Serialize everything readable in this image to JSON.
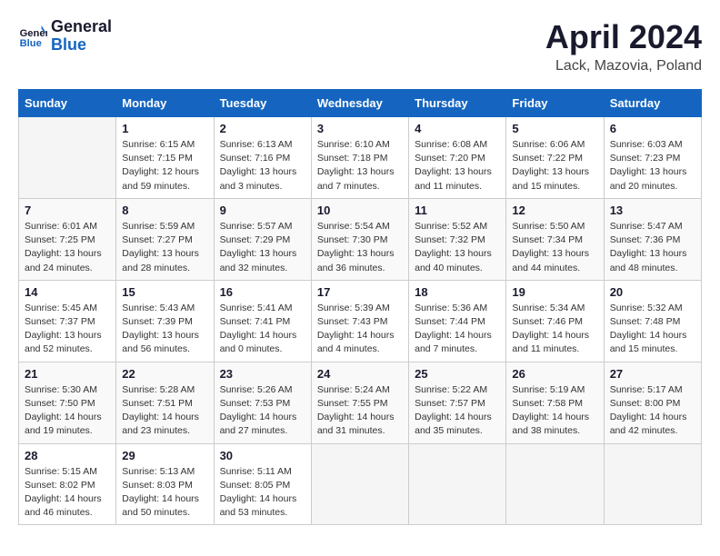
{
  "header": {
    "logo_line1": "General",
    "logo_line2": "Blue",
    "month_year": "April 2024",
    "location": "Lack, Mazovia, Poland"
  },
  "weekdays": [
    "Sunday",
    "Monday",
    "Tuesday",
    "Wednesday",
    "Thursday",
    "Friday",
    "Saturday"
  ],
  "weeks": [
    [
      {
        "day": "",
        "info": ""
      },
      {
        "day": "1",
        "info": "Sunrise: 6:15 AM\nSunset: 7:15 PM\nDaylight: 12 hours\nand 59 minutes."
      },
      {
        "day": "2",
        "info": "Sunrise: 6:13 AM\nSunset: 7:16 PM\nDaylight: 13 hours\nand 3 minutes."
      },
      {
        "day": "3",
        "info": "Sunrise: 6:10 AM\nSunset: 7:18 PM\nDaylight: 13 hours\nand 7 minutes."
      },
      {
        "day": "4",
        "info": "Sunrise: 6:08 AM\nSunset: 7:20 PM\nDaylight: 13 hours\nand 11 minutes."
      },
      {
        "day": "5",
        "info": "Sunrise: 6:06 AM\nSunset: 7:22 PM\nDaylight: 13 hours\nand 15 minutes."
      },
      {
        "day": "6",
        "info": "Sunrise: 6:03 AM\nSunset: 7:23 PM\nDaylight: 13 hours\nand 20 minutes."
      }
    ],
    [
      {
        "day": "7",
        "info": "Sunrise: 6:01 AM\nSunset: 7:25 PM\nDaylight: 13 hours\nand 24 minutes."
      },
      {
        "day": "8",
        "info": "Sunrise: 5:59 AM\nSunset: 7:27 PM\nDaylight: 13 hours\nand 28 minutes."
      },
      {
        "day": "9",
        "info": "Sunrise: 5:57 AM\nSunset: 7:29 PM\nDaylight: 13 hours\nand 32 minutes."
      },
      {
        "day": "10",
        "info": "Sunrise: 5:54 AM\nSunset: 7:30 PM\nDaylight: 13 hours\nand 36 minutes."
      },
      {
        "day": "11",
        "info": "Sunrise: 5:52 AM\nSunset: 7:32 PM\nDaylight: 13 hours\nand 40 minutes."
      },
      {
        "day": "12",
        "info": "Sunrise: 5:50 AM\nSunset: 7:34 PM\nDaylight: 13 hours\nand 44 minutes."
      },
      {
        "day": "13",
        "info": "Sunrise: 5:47 AM\nSunset: 7:36 PM\nDaylight: 13 hours\nand 48 minutes."
      }
    ],
    [
      {
        "day": "14",
        "info": "Sunrise: 5:45 AM\nSunset: 7:37 PM\nDaylight: 13 hours\nand 52 minutes."
      },
      {
        "day": "15",
        "info": "Sunrise: 5:43 AM\nSunset: 7:39 PM\nDaylight: 13 hours\nand 56 minutes."
      },
      {
        "day": "16",
        "info": "Sunrise: 5:41 AM\nSunset: 7:41 PM\nDaylight: 14 hours\nand 0 minutes."
      },
      {
        "day": "17",
        "info": "Sunrise: 5:39 AM\nSunset: 7:43 PM\nDaylight: 14 hours\nand 4 minutes."
      },
      {
        "day": "18",
        "info": "Sunrise: 5:36 AM\nSunset: 7:44 PM\nDaylight: 14 hours\nand 7 minutes."
      },
      {
        "day": "19",
        "info": "Sunrise: 5:34 AM\nSunset: 7:46 PM\nDaylight: 14 hours\nand 11 minutes."
      },
      {
        "day": "20",
        "info": "Sunrise: 5:32 AM\nSunset: 7:48 PM\nDaylight: 14 hours\nand 15 minutes."
      }
    ],
    [
      {
        "day": "21",
        "info": "Sunrise: 5:30 AM\nSunset: 7:50 PM\nDaylight: 14 hours\nand 19 minutes."
      },
      {
        "day": "22",
        "info": "Sunrise: 5:28 AM\nSunset: 7:51 PM\nDaylight: 14 hours\nand 23 minutes."
      },
      {
        "day": "23",
        "info": "Sunrise: 5:26 AM\nSunset: 7:53 PM\nDaylight: 14 hours\nand 27 minutes."
      },
      {
        "day": "24",
        "info": "Sunrise: 5:24 AM\nSunset: 7:55 PM\nDaylight: 14 hours\nand 31 minutes."
      },
      {
        "day": "25",
        "info": "Sunrise: 5:22 AM\nSunset: 7:57 PM\nDaylight: 14 hours\nand 35 minutes."
      },
      {
        "day": "26",
        "info": "Sunrise: 5:19 AM\nSunset: 7:58 PM\nDaylight: 14 hours\nand 38 minutes."
      },
      {
        "day": "27",
        "info": "Sunrise: 5:17 AM\nSunset: 8:00 PM\nDaylight: 14 hours\nand 42 minutes."
      }
    ],
    [
      {
        "day": "28",
        "info": "Sunrise: 5:15 AM\nSunset: 8:02 PM\nDaylight: 14 hours\nand 46 minutes."
      },
      {
        "day": "29",
        "info": "Sunrise: 5:13 AM\nSunset: 8:03 PM\nDaylight: 14 hours\nand 50 minutes."
      },
      {
        "day": "30",
        "info": "Sunrise: 5:11 AM\nSunset: 8:05 PM\nDaylight: 14 hours\nand 53 minutes."
      },
      {
        "day": "",
        "info": ""
      },
      {
        "day": "",
        "info": ""
      },
      {
        "day": "",
        "info": ""
      },
      {
        "day": "",
        "info": ""
      }
    ]
  ]
}
